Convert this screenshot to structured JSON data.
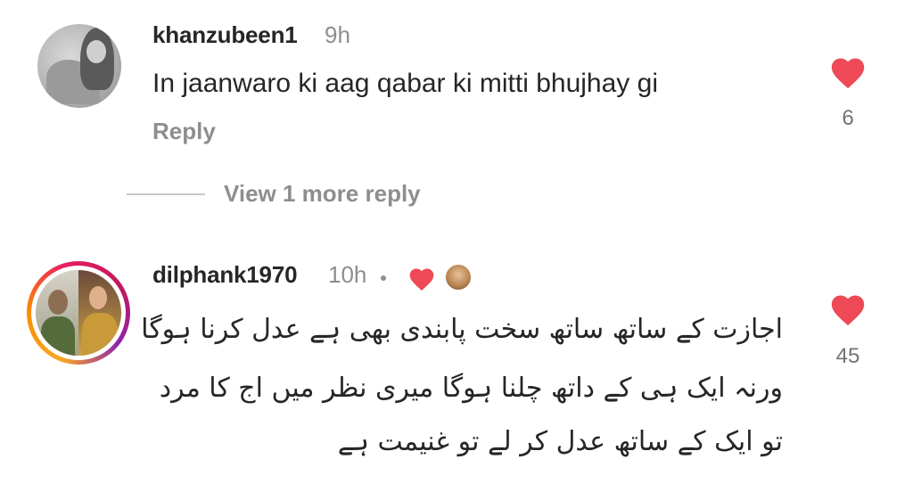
{
  "comments": [
    {
      "username": "khanzubeen1",
      "time": "9h",
      "text": "In jaanwaro ki aag qabar ki mitti bhujhay gi",
      "reply_label": "Reply",
      "like_count": "6",
      "view_more": "View 1 more reply"
    },
    {
      "username": "dilphank1970",
      "time": "10h",
      "text_lines": [
        "اجازت کے ساتھ ساتھ سخت پابندی بھی ہے عدل کرنا ہوگا",
        "ورنہ ایک ہی کے داتھ چلنا ہوگا میری نظر میں اج کا مرد",
        "تو ایک کے ساتھ عدل کر لے تو غنیمت ہے"
      ],
      "like_count": "45"
    }
  ],
  "colors": {
    "heart": "#ed4956",
    "username": "#262626",
    "meta": "#8e8e8e"
  },
  "icons": {
    "like": "heart-icon",
    "creator_liked": "heart-icon"
  }
}
